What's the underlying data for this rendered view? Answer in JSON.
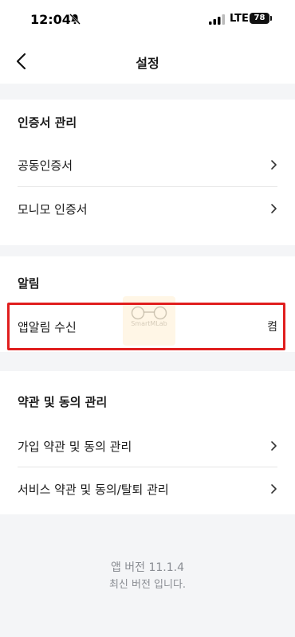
{
  "status_bar": {
    "time": "12:04",
    "network": "LTE",
    "battery": "78",
    "icons": [
      "bell-off-icon",
      "signal-icon"
    ]
  },
  "header": {
    "title": "설정",
    "back_icon": "chevron-left-icon"
  },
  "sections": {
    "certificate": {
      "title": "인증서 관리",
      "items": [
        {
          "label": "공동인증서"
        },
        {
          "label": "모니모 인증서"
        }
      ]
    },
    "notification": {
      "title": "알림",
      "items": [
        {
          "label": "앱알림 수신",
          "value": "켬"
        }
      ]
    },
    "terms": {
      "title": "약관 및 동의 관리",
      "items": [
        {
          "label": "가입 약관 및 동의 관리"
        },
        {
          "label": "서비스 약관 및 동의/탈퇴 관리"
        }
      ]
    }
  },
  "footer": {
    "version": "앱 버전 11.1.4",
    "note": "최신 버전 입니다."
  },
  "watermark": {
    "text": "SmartMLab"
  },
  "colors": {
    "highlight": "#e01e1e",
    "background": "#f4f5f7",
    "footer_text": "#8a8d93"
  }
}
